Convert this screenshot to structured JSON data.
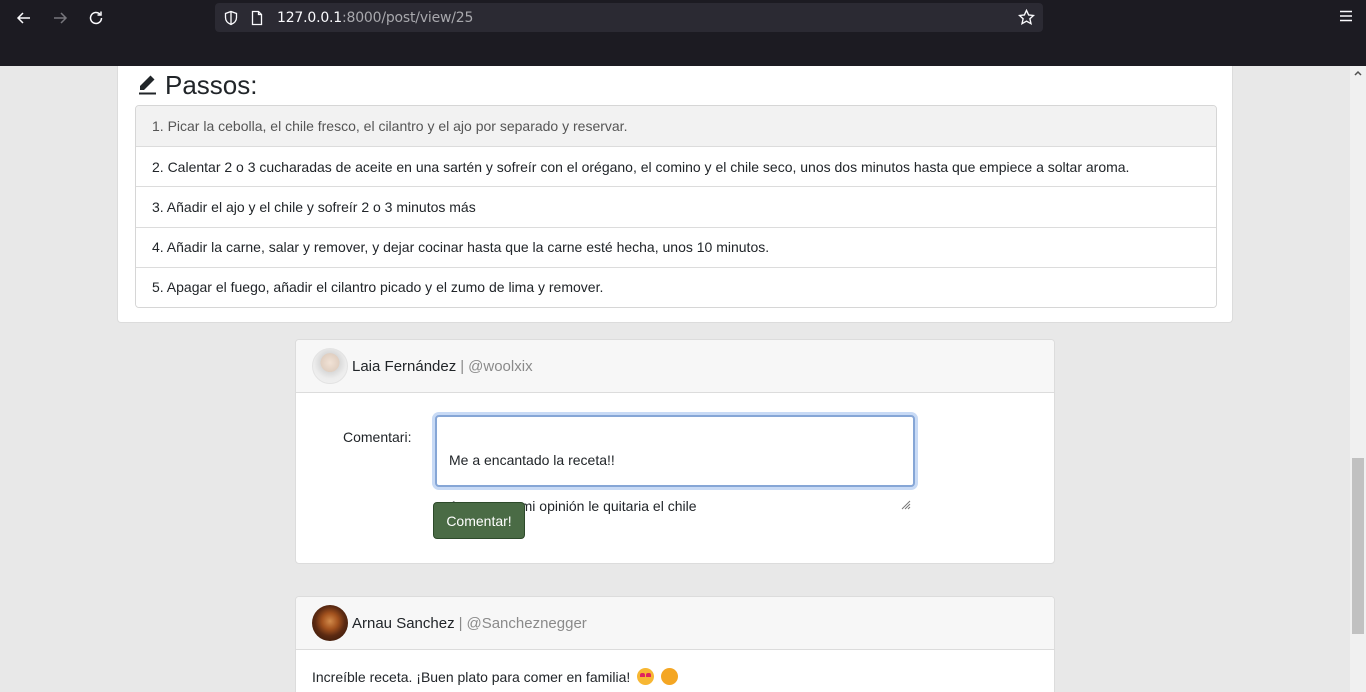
{
  "browser": {
    "url_host": "127.0.0.1",
    "url_rest": ":8000/post/view/25"
  },
  "steps": {
    "title": "Passos:",
    "items": [
      "1. Picar la cebolla, el chile fresco, el cilantro y el ajo por separado y reservar.",
      "2. Calentar 2 o 3 cucharadas de aceite en una sartén y sofreír con el orégano, el comino y el chile seco, unos dos minutos hasta que empiece a soltar aroma.",
      "3. Añadir el ajo y el chile y sofreír 2 o 3 minutos más",
      "4. Añadir la carne, salar y remover, y dejar cocinar hasta que la carne esté hecha, unos 10 minutos.",
      "5. Apagar el fuego, añadir el cilantro picado y el zumo de lima y remover."
    ]
  },
  "comment_form": {
    "user_name": "Laia Fernández",
    "separator": "|",
    "handle": "@woolxix",
    "label": "Comentari:",
    "textarea_line1": "Me a encantado la receta!!",
    "textarea_line2": "Aunque en mi opinión le quitaria el chile",
    "submit_label": "Comentar!"
  },
  "comments": [
    {
      "user_name": "Arnau Sanchez",
      "separator": "|",
      "handle": "@Sancheznegger",
      "text": "Increíble receta. ¡Buen plato para comer en familia!"
    }
  ]
}
